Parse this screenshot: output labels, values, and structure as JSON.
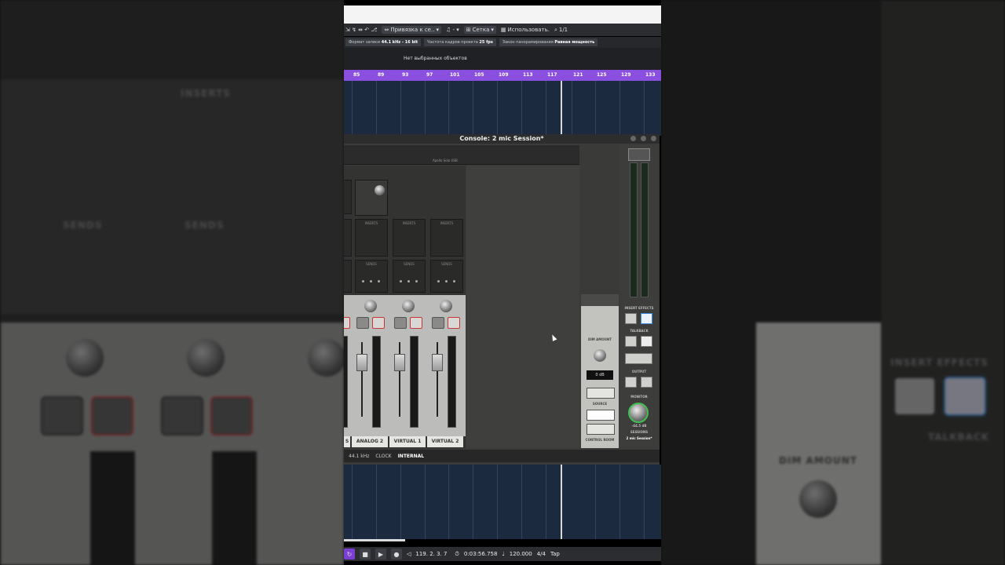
{
  "toolbar": {
    "snap_label": "Привязка к се..",
    "grid_label": "Сетка",
    "use_label": "Использовать.",
    "counter": "1/1"
  },
  "status": {
    "record_format_label": "Формат записи",
    "record_format_value": "44.1 kHz - 16 bit",
    "frame_rate_label": "Частота кадров проекта",
    "frame_rate_value": "25 fps",
    "pan_law_label": "Закон панорамирования",
    "pan_law_value": "Равная мощность"
  },
  "info": {
    "no_selection": "Нет выбранных объектов"
  },
  "ruler": {
    "marks": [
      "85",
      "89",
      "93",
      "97",
      "101",
      "105",
      "109",
      "113",
      "117",
      "121",
      "125",
      "129",
      "133"
    ]
  },
  "console": {
    "title": "Console: 2 mic Session*",
    "apollo_label": "Apollo Solo USB",
    "channels": [
      {
        "name": "S"
      },
      {
        "name": "ANALOG 2"
      },
      {
        "name": "VIRTUAL 1"
      },
      {
        "name": "VIRTUAL 2"
      }
    ],
    "inserts_label": "INSERTS",
    "sends_label": "SENDS",
    "dim_amount_label": "DIM AMOUNT",
    "dim_value": "0 dB",
    "source_label": "SOURCE",
    "control_room_label": "CONTROL ROOM",
    "insert_effects_label": "INSERT EFFECTS",
    "talkback_label": "TALKBACK",
    "output_label": "OUTPUT",
    "monitor_label": "MONITOR",
    "monitor_value": "-44.5 dB",
    "session_label": "SESSIONS",
    "session_value": "2 mic Session*",
    "sample_rate": "44.1 kHz",
    "clock_label": "CLOCK",
    "clock_value": "INTERNAL"
  },
  "transport": {
    "position": "119. 2. 3.   7",
    "time": "0:03:56.758",
    "tempo": "120.000",
    "signature": "4/4",
    "tap": "Tap"
  },
  "colors": {
    "ruler": "#8b4fe0",
    "track_bg": "#1c2a40",
    "accent_green": "#3fbf4f"
  }
}
